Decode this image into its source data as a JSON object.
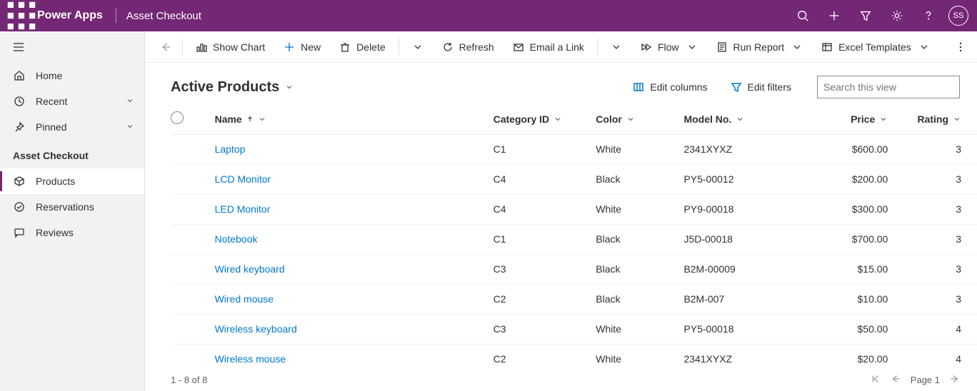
{
  "topbar": {
    "brand": "Power Apps",
    "env": "Asset Checkout",
    "user_initials": "SS"
  },
  "sidebar": {
    "items": [
      {
        "label": "Home"
      },
      {
        "label": "Recent"
      },
      {
        "label": "Pinned"
      }
    ],
    "group_label": "Asset Checkout",
    "group_items": [
      {
        "label": "Products"
      },
      {
        "label": "Reservations"
      },
      {
        "label": "Reviews"
      }
    ]
  },
  "cmdbar": {
    "show_chart": "Show Chart",
    "new": "New",
    "delete": "Delete",
    "refresh": "Refresh",
    "email_link": "Email a Link",
    "flow": "Flow",
    "run_report": "Run Report",
    "excel_templates": "Excel Templates"
  },
  "view": {
    "title": "Active Products",
    "edit_columns": "Edit columns",
    "edit_filters": "Edit filters",
    "search_placeholder": "Search this view"
  },
  "columns": {
    "name": "Name",
    "category": "Category ID",
    "color": "Color",
    "model": "Model No.",
    "price": "Price",
    "rating": "Rating"
  },
  "rows": [
    {
      "name": "Laptop",
      "category": "C1",
      "color": "White",
      "model": "2341XYXZ",
      "price": "$600.00",
      "rating": "3"
    },
    {
      "name": "LCD Monitor",
      "category": "C4",
      "color": "Black",
      "model": "PY5-00012",
      "price": "$200.00",
      "rating": "3"
    },
    {
      "name": "LED Monitor",
      "category": "C4",
      "color": "White",
      "model": "PY9-00018",
      "price": "$300.00",
      "rating": "3"
    },
    {
      "name": "Notebook",
      "category": "C1",
      "color": "Black",
      "model": "J5D-00018",
      "price": "$700.00",
      "rating": "3"
    },
    {
      "name": "Wired keyboard",
      "category": "C3",
      "color": "Black",
      "model": "B2M-00009",
      "price": "$15.00",
      "rating": "3"
    },
    {
      "name": "Wired mouse",
      "category": "C2",
      "color": "Black",
      "model": "B2M-007",
      "price": "$10.00",
      "rating": "3"
    },
    {
      "name": "Wireless keyboard",
      "category": "C3",
      "color": "White",
      "model": "PY5-00018",
      "price": "$50.00",
      "rating": "4"
    },
    {
      "name": "Wireless mouse",
      "category": "C2",
      "color": "White",
      "model": "2341XYXZ",
      "price": "$20.00",
      "rating": "4"
    }
  ],
  "footer": {
    "count_text": "1 - 8 of 8",
    "page_text": "Page 1"
  }
}
